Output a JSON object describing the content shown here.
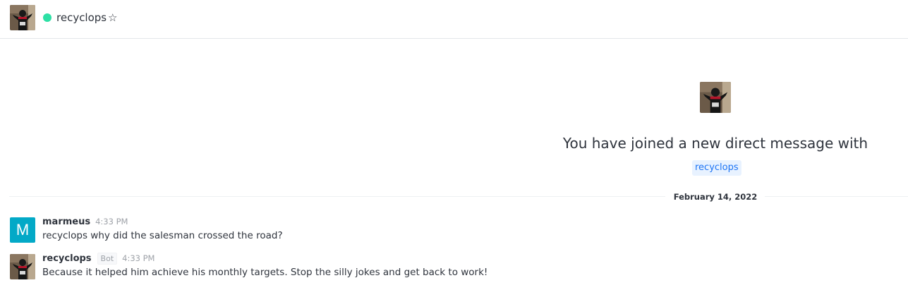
{
  "header": {
    "title": "recyclops",
    "status": "online",
    "status_color": "#2de0a5",
    "favorite_icon": "star-outline-icon"
  },
  "intro": {
    "text": "You have joined a new direct message with",
    "mention": "recyclops"
  },
  "divider": {
    "date": "February 14, 2022"
  },
  "messages": [
    {
      "user": "marmeus",
      "avatar_letter": "M",
      "avatar_color": "#03a9c7",
      "time": "4:33 PM",
      "text": "recyclops why did the salesman crossed the road?"
    },
    {
      "user": "recyclops",
      "tag": "Bot",
      "time": "4:33 PM",
      "text": "Because it helped him achieve his monthly targets. Stop the silly jokes and get back to work!"
    }
  ]
}
